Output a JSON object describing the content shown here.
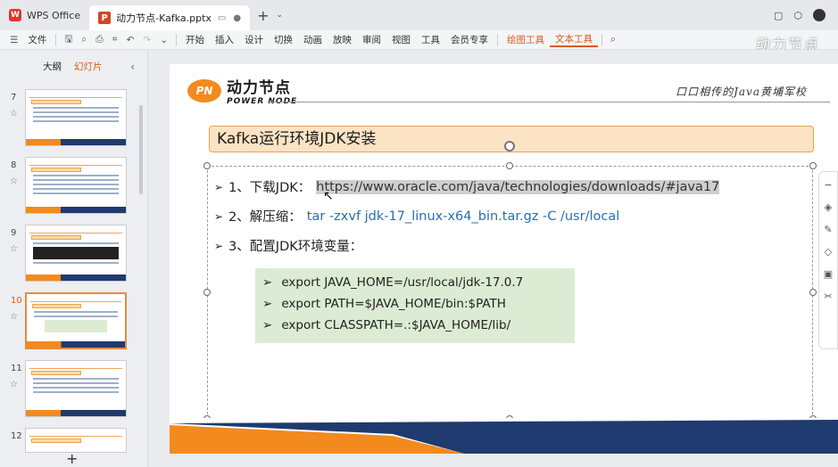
{
  "tabs": {
    "app_tab": "WPS Office",
    "doc_tab": "动力节点-Kafka.pptx",
    "new_tab": "+"
  },
  "toolbar": {
    "file": "文件",
    "items": [
      "开始",
      "插入",
      "设计",
      "切换",
      "动画",
      "放映",
      "审阅",
      "视图",
      "工具",
      "会员专享",
      "绘图工具",
      "文本工具"
    ],
    "active_item": "文本工具"
  },
  "watermark": "动力节点",
  "left_panel": {
    "tab_outline": "大纲",
    "tab_slides": "幻灯片",
    "slide_numbers": [
      "7",
      "8",
      "9",
      "10",
      "11",
      "12"
    ],
    "selected_slide": "10",
    "add_slide": "+"
  },
  "slide": {
    "brand_cn": "动力节点",
    "brand_en": "POWER NODE",
    "brand_badge": "PN",
    "slogan": "口口相传的Java黄埔军校",
    "title": "Kafka运行环境JDK安装",
    "step1_label": "1、下载JDK：",
    "step1_url": "https://www.oracle.com/java/technologies/downloads/#java17",
    "step2_label": "2、解压缩：",
    "step2_cmd": "tar -zxvf jdk-17_linux-x64_bin.tar.gz -C /usr/local",
    "step3_label": "3、配置JDK环境变量：",
    "code_lines": [
      "export JAVA_HOME=/usr/local/jdk-17.0.7",
      "export PATH=$JAVA_HOME/bin:$PATH",
      "export CLASSPATH=.:$JAVA_HOME/lib/"
    ]
  },
  "colors": {
    "accent": "#d85a15",
    "title_fill": "#fbe3c3",
    "code_fill": "#dcebd3",
    "footer_orange": "#f28a1e",
    "footer_navy": "#1f3a6e"
  }
}
